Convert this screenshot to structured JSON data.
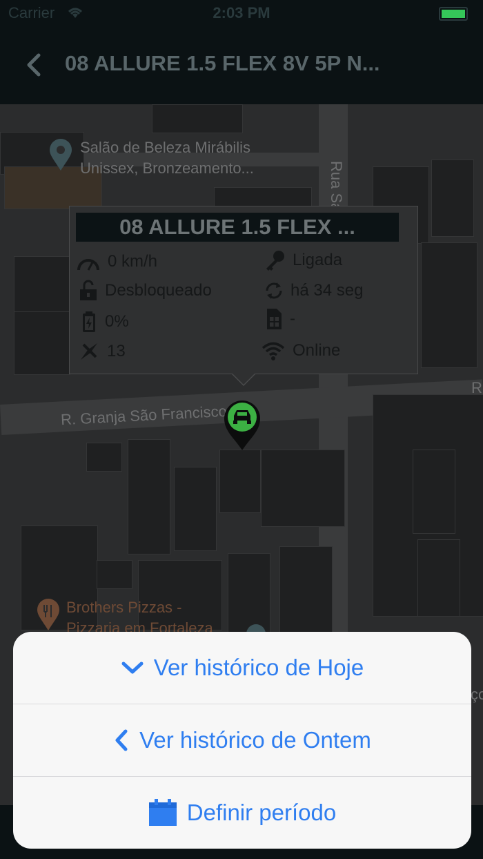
{
  "status_bar": {
    "carrier": "Carrier",
    "time": "2:03 PM"
  },
  "nav": {
    "title": "08 ALLURE 1.5 FLEX 8V 5P N..."
  },
  "map": {
    "poi_salon_line1": "Salão de Beleza Mirábilis",
    "poi_salon_line2": "Unissex, Bronzeamento...",
    "street_rua": "Rua Sa",
    "street_granja": "R. Granja São Francisco",
    "street_right": "R",
    "poi_pizza_line1": "Brothers Pizzas -",
    "poi_pizza_line2": "Pizzaria em Fortaleza",
    "right_edge_text": "ço"
  },
  "callout": {
    "title": "08 ALLURE 1.5 FLEX ...",
    "speed": "0 km/h",
    "ignition": "Ligada",
    "lock": "Desbloqueado",
    "last_update": "há 34 seg",
    "battery": "0%",
    "sim": "-",
    "satellites": "13",
    "connection": "Online"
  },
  "sheet": {
    "today": "Ver histórico de Hoje",
    "yesterday": "Ver histórico de Ontem",
    "period": "Definir período"
  },
  "colors": {
    "accent": "#2f7ef0",
    "pin": "#3cb043",
    "battery": "#35c759"
  }
}
